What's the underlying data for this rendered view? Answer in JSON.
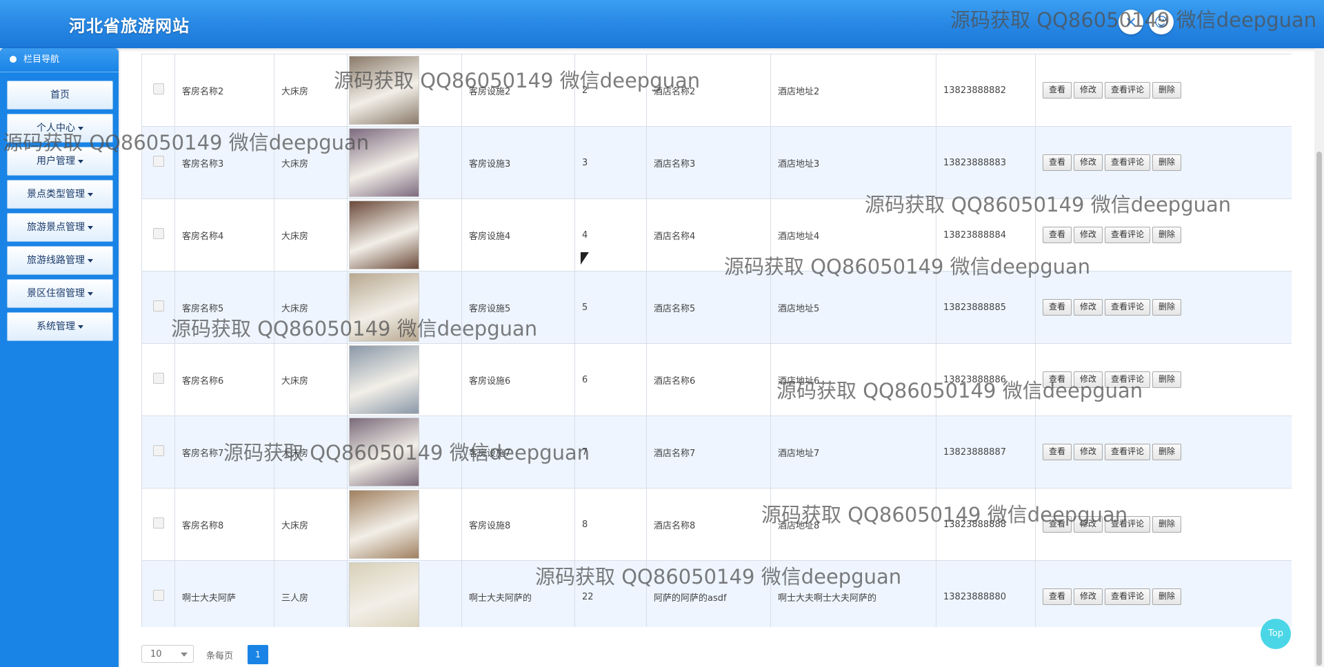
{
  "app_title": "河北省旅游网站",
  "header_buttons": [
    {
      "icon": "close-fullscreen-icon",
      "glyph": "✕"
    },
    {
      "icon": "user-icon",
      "glyph": "👤"
    }
  ],
  "sidebar": {
    "title": "栏目导航",
    "items": [
      {
        "label": "首页",
        "dropdown": false
      },
      {
        "label": "个人中心",
        "dropdown": true
      },
      {
        "label": "用户管理",
        "dropdown": true
      },
      {
        "label": "景点类型管理",
        "dropdown": true
      },
      {
        "label": "旅游景点管理",
        "dropdown": true
      },
      {
        "label": "旅游线路管理",
        "dropdown": true
      },
      {
        "label": "景区住宿管理",
        "dropdown": true
      },
      {
        "label": "系统管理",
        "dropdown": true
      }
    ]
  },
  "table": {
    "actions": [
      "查看",
      "修改",
      "查看评论",
      "删除"
    ],
    "rows": [
      {
        "name": "客房名称2",
        "type": "大床房",
        "facility": "客房设施2",
        "num": "2",
        "hotel": "酒店名称2",
        "address": "酒店地址2",
        "phone": "13823888882",
        "img_color": "#8a7a6a"
      },
      {
        "name": "客房名称3",
        "type": "大床房",
        "facility": "客房设施3",
        "num": "3",
        "hotel": "酒店名称3",
        "address": "酒店地址3",
        "phone": "13823888883",
        "img_color": "#7d6a7f"
      },
      {
        "name": "客房名称4",
        "type": "大床房",
        "facility": "客房设施4",
        "num": "4",
        "hotel": "酒店名称4",
        "address": "酒店地址4",
        "phone": "13823888884",
        "img_color": "#6b4a3a"
      },
      {
        "name": "客房名称5",
        "type": "大床房",
        "facility": "客房设施5",
        "num": "5",
        "hotel": "酒店名称5",
        "address": "酒店地址5",
        "phone": "13823888885",
        "img_color": "#b8a890"
      },
      {
        "name": "客房名称6",
        "type": "大床房",
        "facility": "客房设施6",
        "num": "6",
        "hotel": "酒店名称6",
        "address": "酒店地址6",
        "phone": "13823888886",
        "img_color": "#8a98a8"
      },
      {
        "name": "客房名称7",
        "type": "大床房",
        "facility": "客房设施7",
        "num": "7",
        "hotel": "酒店名称7",
        "address": "酒店地址7",
        "phone": "13823888887",
        "img_color": "#7a6a7a"
      },
      {
        "name": "客房名称8",
        "type": "大床房",
        "facility": "客房设施8",
        "num": "8",
        "hotel": "酒店名称8",
        "address": "酒店地址8",
        "phone": "13823888888",
        "img_color": "#a08060"
      },
      {
        "name": "啊士大夫阿萨",
        "type": "三人房",
        "facility": "啊士大夫阿萨的",
        "num": "22",
        "hotel": "阿萨的阿萨的asdf",
        "address": "啊士大夫啊士大夫阿萨的",
        "phone": "13823888880",
        "img_color": "#d8d0b8"
      }
    ]
  },
  "pagination": {
    "page_size": "10",
    "per_page_label": "条每页",
    "current_page": "1"
  },
  "top_button": "Top",
  "watermark": "源码获取 QQ86050149 微信deepguan"
}
